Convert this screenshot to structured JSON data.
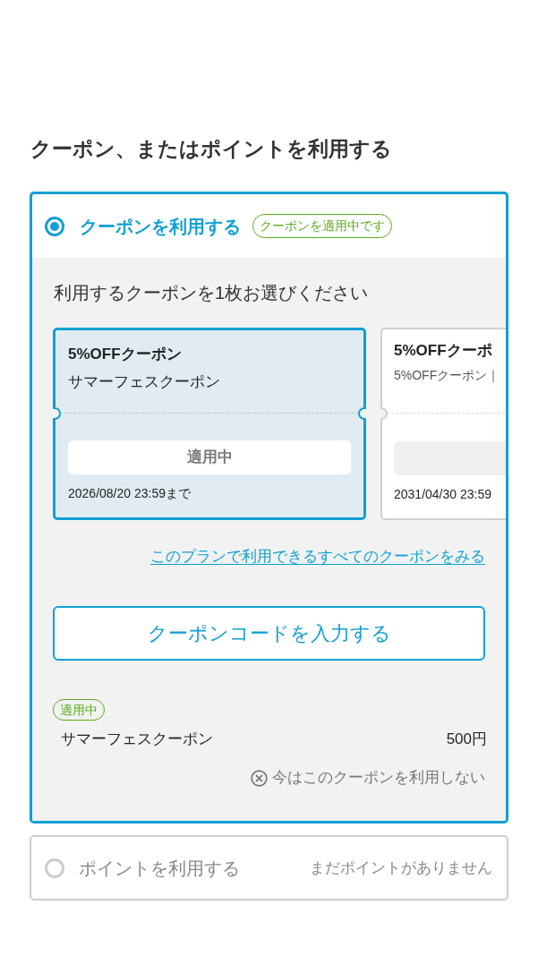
{
  "heading": "クーポン、またはポイントを利用する",
  "options": [
    {
      "kind": "coupon",
      "label": "クーポンを利用する",
      "selected": true,
      "badge": "クーポンを適用中です",
      "panel": {
        "instruction": "利用するクーポンを1枚お選びください",
        "coupons": [
          {
            "title": "5%OFFクーポン",
            "name": "サマーフェスクーポン",
            "button": "適用中",
            "expiry": "2026/08/20 23:59まで",
            "selected": true
          },
          {
            "title": "5%OFFクーポ",
            "description": "5%OFFクーポン｜",
            "expiry": "2031/04/30 23:59",
            "selected": false
          }
        ],
        "all_coupons_link": "このプランで利用できるすべてのクーポンをみる",
        "code_button": "クーポンコードを入力する",
        "applied": {
          "badge": "適用中",
          "name": "サマーフェスクーポン",
          "amount": "500円"
        },
        "remove_link": "今はこのクーポンを利用しない"
      }
    },
    {
      "kind": "points",
      "label": "ポイントを利用する",
      "selected": false,
      "note": "まだポイントがありません"
    }
  ]
}
